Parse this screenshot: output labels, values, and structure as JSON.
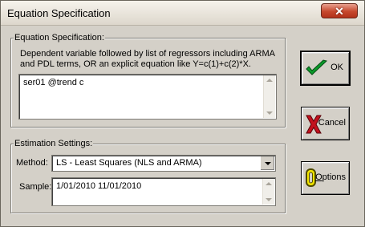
{
  "window": {
    "title": "Equation Specification",
    "close_glyph": "✕"
  },
  "equation_group": {
    "label": "Equation Specification:",
    "hint": "Dependent variable followed by list of regressors including ARMA and PDL terms, OR an explicit equation like Y=c(1)+c(2)*X.",
    "text": "ser01 @trend c"
  },
  "estimation_group": {
    "label": "Estimation Settings:",
    "method_label": "Method:",
    "method_value": "LS  -  Least Squares (NLS and ARMA)",
    "sample_label": "Sample:",
    "sample_value": "1/01/2010 11/01/2010"
  },
  "buttons": {
    "ok": "OK",
    "cancel": "Cancel",
    "options_prefix": "O",
    "options_rest": "ptions"
  },
  "icons": {
    "ok": "checkmark-icon",
    "cancel": "x-icon",
    "options": "options-icon"
  }
}
